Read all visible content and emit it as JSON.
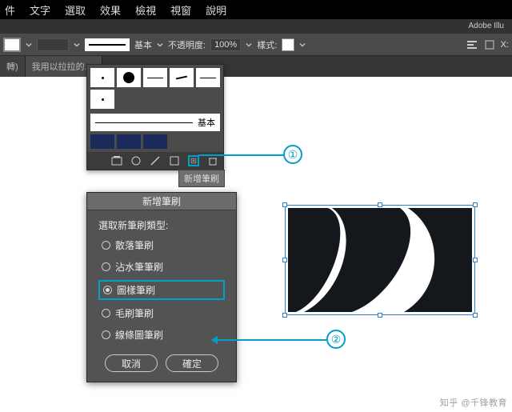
{
  "menubar": {
    "items": [
      "件",
      "文字",
      "選取",
      "效果",
      "檢視",
      "視窗",
      "說明"
    ]
  },
  "titlebar": {
    "app": "Adobe Illu"
  },
  "optbar": {
    "basic_label": "基本",
    "opacity_label": "不透明度:",
    "opacity_value": "100%",
    "style_label": "樣式:",
    "x_label": "X:"
  },
  "tabs": {
    "left": "轉)",
    "active": "我用以拉拉的."
  },
  "brushes": {
    "basic_label": "基本",
    "tooltip": "新增筆刷"
  },
  "dialog": {
    "title": "新增筆刷",
    "prompt": "選取新筆刷類型:",
    "options": [
      "散落筆刷",
      "沾水筆筆刷",
      "圖樣筆刷",
      "毛刷筆刷",
      "線條圖筆刷"
    ],
    "selected_index": 2,
    "cancel": "取消",
    "ok": "確定"
  },
  "callouts": {
    "one": "①",
    "two": "②"
  },
  "watermark": "知乎 @千锋教育"
}
